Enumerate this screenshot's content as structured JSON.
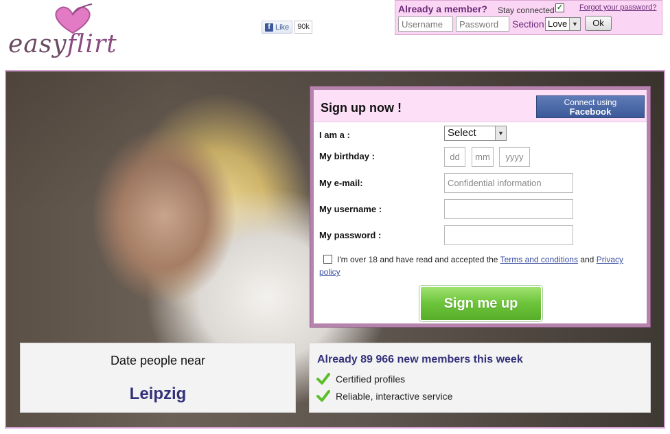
{
  "header": {
    "logo": {
      "part1": "easy",
      "part2": "flirt"
    },
    "facebook_like": {
      "label": "Like",
      "count": "90k"
    },
    "login": {
      "title": "Already a member?",
      "stay_connected": "Stay connected",
      "stay_connected_checked": true,
      "forgot_password": "Forgot your password?",
      "username_placeholder": "Username",
      "password_placeholder": "Password",
      "section_label": "Section",
      "section_value": "Love",
      "ok_label": "Ok"
    }
  },
  "signup": {
    "title": "Sign up now !",
    "facebook_connect_line1": "Connect using",
    "facebook_connect_line2": "Facebook",
    "iam_label": "I am a :",
    "iam_value": "Select",
    "birthday_label": "My birthday :",
    "birthday_day_placeholder": "dd",
    "birthday_month_placeholder": "mm",
    "birthday_year_placeholder": "yyyy",
    "email_label": "My e-mail:",
    "email_placeholder": "Confidential information",
    "username_label": "My username :",
    "password_label": "My password :",
    "agree_text": "I'm over 18 and have read and accepted the",
    "terms_link": "Terms and conditions",
    "and_text": "and",
    "privacy_link": "Privacy policy",
    "submit_label": "Sign me up"
  },
  "date_near": {
    "title": "Date people near",
    "city": "Leipzig"
  },
  "members": {
    "title": "Already 89 966 new members this week",
    "features": [
      "Certified profiles",
      "Reliable, interactive service"
    ]
  },
  "colors": {
    "brand_purple": "#6a2a78",
    "login_bg": "#fbd6f4",
    "signup_header_bg": "#fde0f7",
    "facebook_blue": "#3b5998",
    "cta_green": "#6cc43a",
    "navy_text": "#33317a"
  }
}
